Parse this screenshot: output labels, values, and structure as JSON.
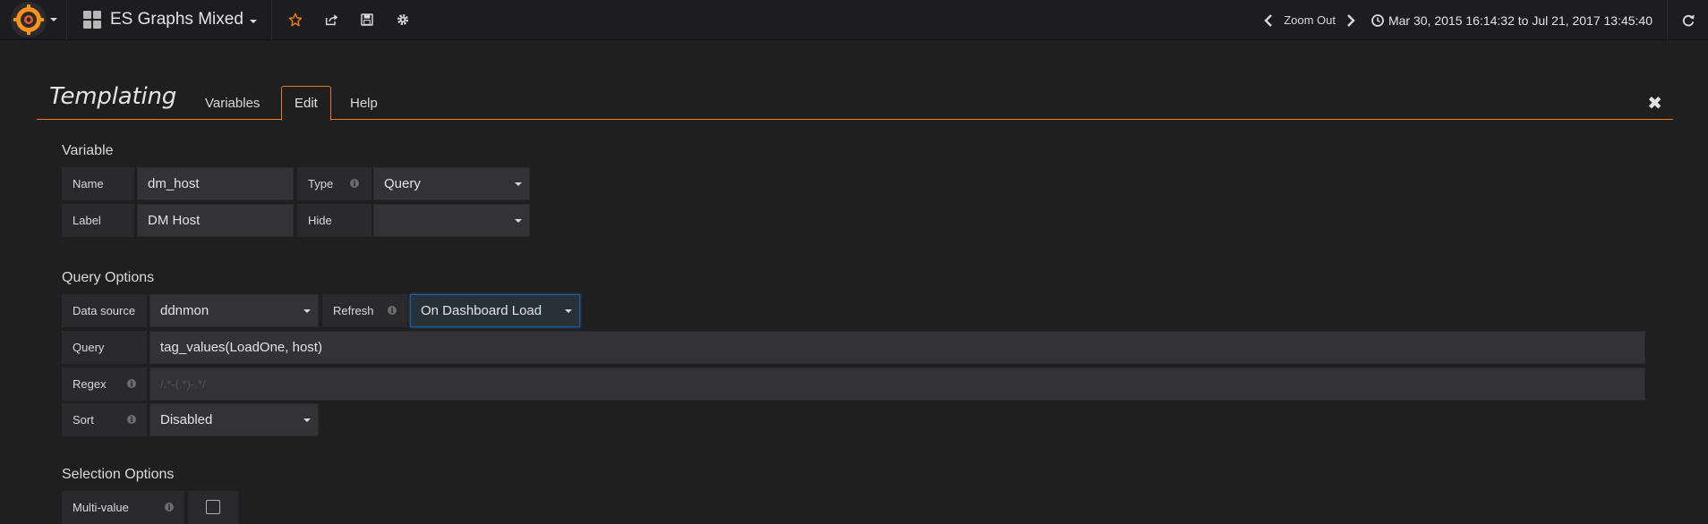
{
  "navbar": {
    "dashboard_title": "ES Graphs Mixed",
    "zoom_out_label": "Zoom Out",
    "time_range": "Mar 30, 2015 16:14:32 to Jul 21, 2017 13:45:40"
  },
  "templating": {
    "title": "Templating",
    "tabs": [
      "Variables",
      "Edit",
      "Help"
    ],
    "active_tab": "Edit",
    "close_glyph": "✖"
  },
  "variable": {
    "section_title": "Variable",
    "name_label": "Name",
    "name_value": "dm_host",
    "type_label": "Type",
    "type_value": "Query",
    "label_label": "Label",
    "label_value": "DM Host",
    "hide_label": "Hide",
    "hide_value": ""
  },
  "query_options": {
    "section_title": "Query Options",
    "datasource_label": "Data source",
    "datasource_value": "ddnmon",
    "refresh_label": "Refresh",
    "refresh_value": "On Dashboard Load",
    "query_label": "Query",
    "query_value": "tag_values(LoadOne, host)",
    "regex_label": "Regex",
    "regex_placeholder": "/.*-(.*)-.*/",
    "sort_label": "Sort",
    "sort_value": "Disabled"
  },
  "selection_options": {
    "section_title": "Selection Options",
    "multi_value_label": "Multi-value",
    "multi_value_checked": false
  },
  "colors": {
    "accent": "#eb7b18",
    "background": "#1f1f20",
    "label_bg": "#2a2a2c",
    "input_bg": "#333335"
  }
}
